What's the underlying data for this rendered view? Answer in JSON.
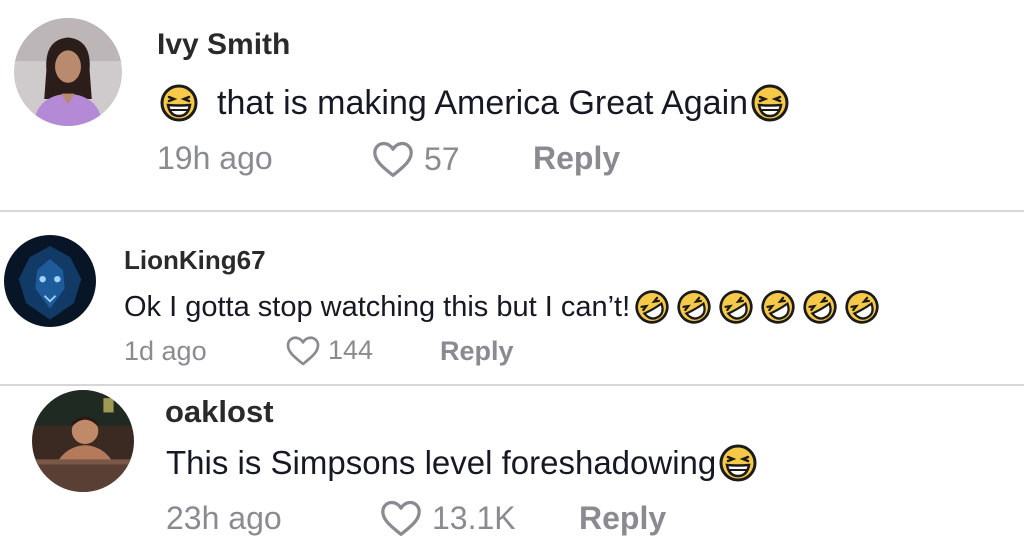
{
  "comments": [
    {
      "username": "Ivy Smith",
      "text": "that is making America Great Again",
      "emoji_before": "grinning-squint-emoji",
      "emoji_after": "grinning-squint-emoji",
      "time": "19h ago",
      "likes": "57",
      "reply_label": "Reply"
    },
    {
      "username": "LionKing67",
      "text": "Ok I gotta stop watching this but I can’t!",
      "emoji_after": "rolling-on-floor-laughing-emoji",
      "emoji_after_count": 6,
      "time": "1d ago",
      "likes": "144",
      "reply_label": "Reply"
    },
    {
      "username": "oaklost",
      "text": "This is Simpsons level foreshadowing",
      "emoji_after": "grinning-squint-emoji",
      "time": "23h ago",
      "likes": "13.1K",
      "reply_label": "Reply"
    }
  ],
  "colors": {
    "text": "#161823",
    "username": "#2a2a2a",
    "secondary": "#8a8b91",
    "divider": "#d6d6d6",
    "emoji_face": "#f7c948"
  }
}
